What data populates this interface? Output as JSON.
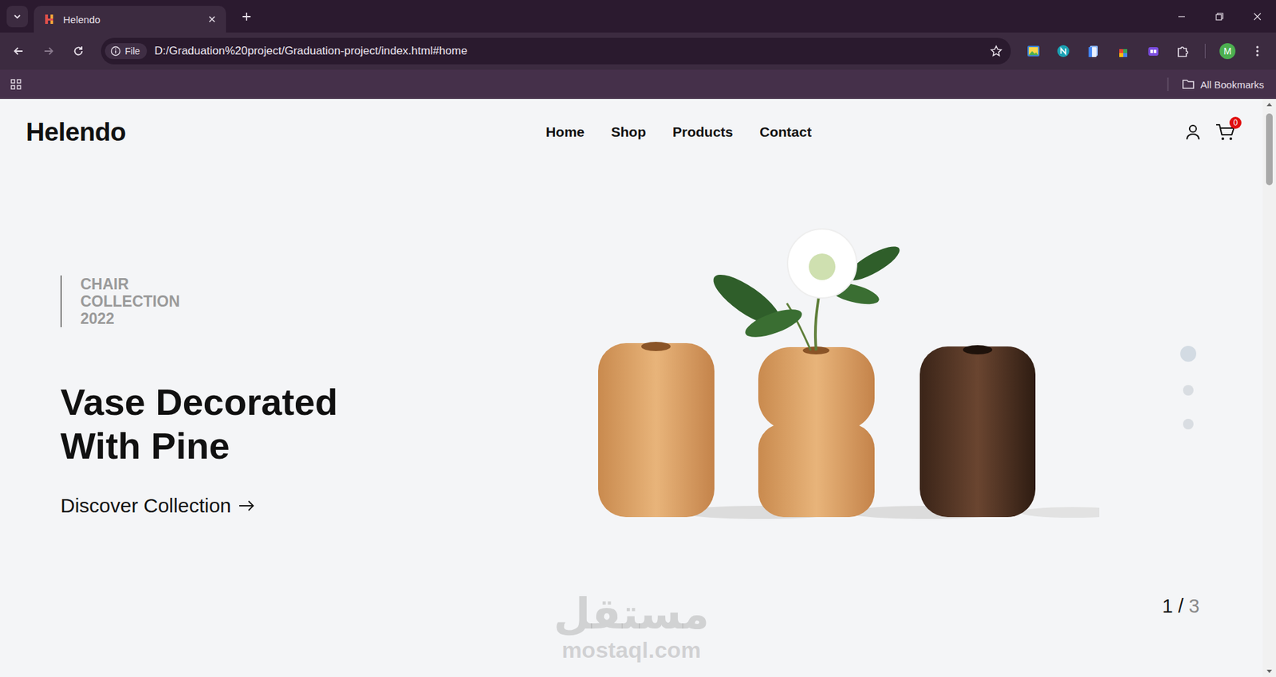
{
  "browser": {
    "tab": {
      "title": "Helendo",
      "selected": true
    },
    "address": {
      "scheme": "File",
      "url": "D:/Graduation%20project/Graduation-project/index.html#home"
    },
    "forward_disabled": true,
    "profile": {
      "initial": "M"
    },
    "bookmarks": {
      "folder": "All Bookmarks"
    }
  },
  "page": {
    "logo": "Helendo",
    "nav": [
      {
        "label": "Home"
      },
      {
        "label": "Shop"
      },
      {
        "label": "Products"
      },
      {
        "label": "Contact"
      }
    ],
    "cart": {
      "count": "0"
    },
    "hero": {
      "eyebrow": [
        "CHAIR",
        "COLLECTION",
        "2022"
      ],
      "title": [
        "Vase Decorated",
        "With Pine"
      ],
      "cta": "Discover Collection"
    },
    "slides": [
      {
        "selected": true
      },
      {
        "selected": false
      },
      {
        "selected": false
      }
    ],
    "counter": {
      "current": "1",
      "separator": "/",
      "total": "3"
    },
    "watermark": {
      "arabic": "مستقل",
      "latin": "mostaql.com"
    }
  }
}
